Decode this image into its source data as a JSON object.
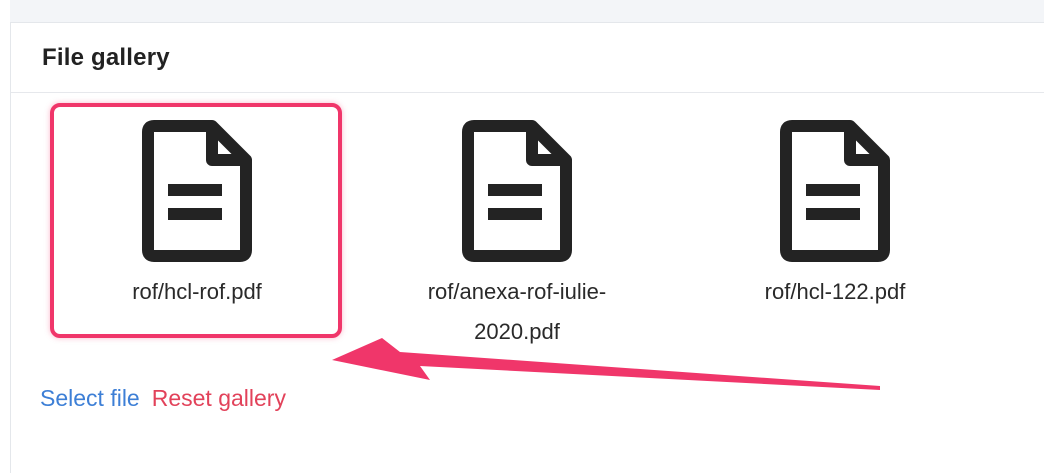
{
  "gallery": {
    "title": "File gallery",
    "files": [
      {
        "name": "rof/hcl-rof.pdf",
        "icon": "file-document-icon",
        "selected": true
      },
      {
        "name": "rof/anexa-rof-iulie-2020.pdf",
        "icon": "file-document-icon",
        "selected": false
      },
      {
        "name": "rof/hcl-122.pdf",
        "icon": "file-document-icon",
        "selected": false
      }
    ],
    "actions": {
      "select_label": "Select file",
      "reset_label": "Reset gallery"
    }
  },
  "annotation": {
    "highlight_color": "#f0366a",
    "arrow_color": "#f0366a"
  },
  "colors": {
    "link_primary": "#3d7fd6",
    "link_danger": "#e2425a",
    "icon": "#232323"
  }
}
